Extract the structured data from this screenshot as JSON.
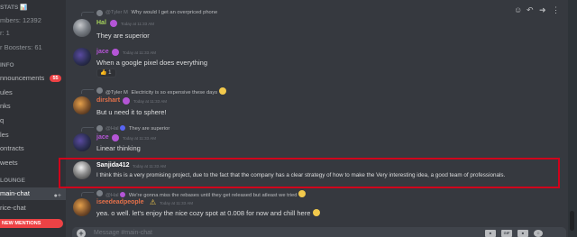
{
  "sidebar": {
    "stats_header": "STATS 📊",
    "members": "mbers: 12392",
    "unknown_row": "r: 1",
    "boosters": "r Boosters: 61",
    "info_category": "INFO",
    "channels": [
      {
        "label": "nnouncements",
        "badge": "55"
      },
      {
        "label": "ules"
      },
      {
        "label": "nks"
      },
      {
        "label": "q"
      },
      {
        "label": "les"
      },
      {
        "label": "ontracts"
      },
      {
        "label": "weets"
      }
    ],
    "lounge_category": "LOUNGE",
    "main_chat": "main-chat",
    "price_chat": "rice-chat",
    "new_mentions": "NEW MENTIONS"
  },
  "messages": [
    {
      "reply_user": "@Tyler M",
      "reply_text": "Why would I get an overpriced phone",
      "user": "Hal",
      "user_color": "#a5d35b",
      "time": "Today at 11:33 AM",
      "text": "They are superior"
    },
    {
      "user": "jace",
      "user_color": "#b455d6",
      "time": "Today at 11:33 AM",
      "text": "When a google pixel does everything",
      "reaction_emoji": "👍",
      "reaction_count": "1"
    },
    {
      "reply_user": "@Tyler M",
      "reply_text": "Electricity is so expensive these days",
      "user": "dirshart",
      "user_color": "#e3704a",
      "time": "Today at 11:33 AM",
      "text": "But u need it to sphere!"
    },
    {
      "reply_user": "@Hal",
      "reply_text": "They are superior",
      "user": "jace",
      "user_color": "#b455d6",
      "time": "Today at 11:33 AM",
      "text": "Linear thinking"
    },
    {
      "user": "Sanjida412",
      "user_color": "#ffffff",
      "time": "Today at 11:33 AM",
      "text": "I think this is a very promising project, due to the fact that the company has a clear strategy of how to make the Very interesting idea, a good team of professionals."
    },
    {
      "reply_user": "@Hal",
      "reply_text": "We're gonna miss the rebases until they get released but atleast we tried",
      "user": "iseedeadpeople",
      "user_color": "#e3704a",
      "time": "Today at 11:33 AM",
      "text": "yea. o well. let's enjoy the nice cozy spot at 0.008 for now and chill here"
    }
  ],
  "composer": {
    "placeholder": "Message #main-chat",
    "gift": "GIF",
    "gif": "GIF"
  },
  "colors": {
    "accent_red": "#ed4245",
    "highlight_border": "#d0021b"
  }
}
